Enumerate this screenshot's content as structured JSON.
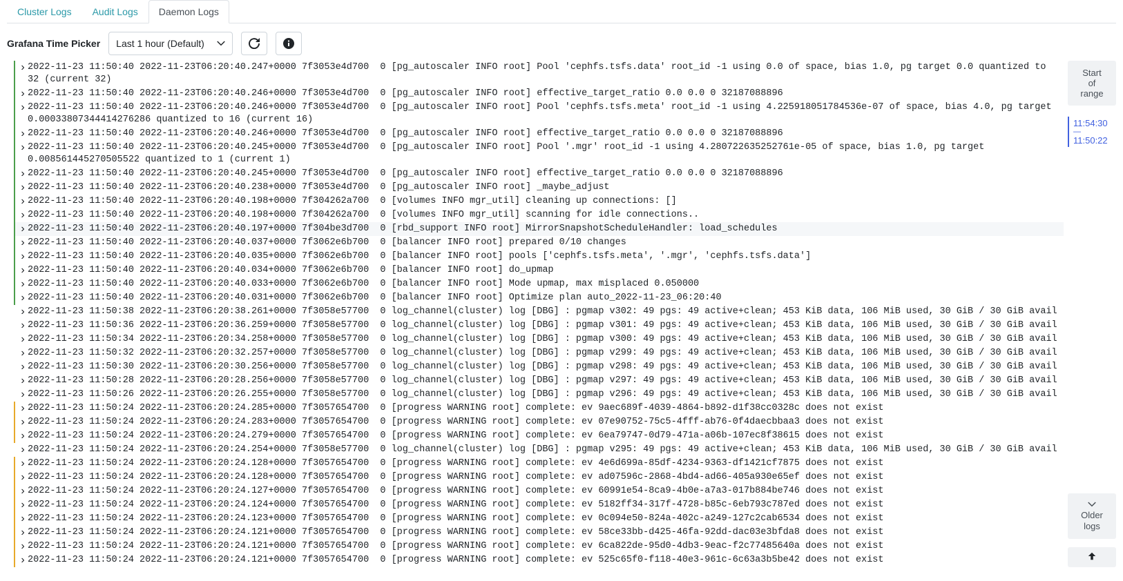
{
  "tabs": [
    {
      "label": "Cluster Logs",
      "active": false
    },
    {
      "label": "Audit Logs",
      "active": false
    },
    {
      "label": "Daemon Logs",
      "active": true
    }
  ],
  "toolbar": {
    "picker_label": "Grafana Time Picker",
    "range_value": "Last 1 hour (Default)"
  },
  "side": {
    "start_label": "Start\nof\nrange",
    "link_top": "11:54:30",
    "link_sep": "—",
    "link_bottom": "11:50:22",
    "older_label": "Older\nlogs"
  },
  "logs": [
    {
      "lvl": "info",
      "hover": false,
      "text": "2022-11-23 11:50:40 2022-11-23T06:20:40.247+0000 7f3053e4d700  0 [pg_autoscaler INFO root] Pool 'cephfs.tsfs.data' root_id -1 using 0.0 of space, bias 1.0, pg target 0.0 quantized to 32 (current 32)"
    },
    {
      "lvl": "info",
      "hover": false,
      "text": "2022-11-23 11:50:40 2022-11-23T06:20:40.246+0000 7f3053e4d700  0 [pg_autoscaler INFO root] effective_target_ratio 0.0 0.0 0 32187088896"
    },
    {
      "lvl": "info",
      "hover": false,
      "text": "2022-11-23 11:50:40 2022-11-23T06:20:40.246+0000 7f3053e4d700  0 [pg_autoscaler INFO root] Pool 'cephfs.tsfs.meta' root_id -1 using 4.225918051784536e-07 of space, bias 4.0, pg target 0.00033807344414276286 quantized to 16 (current 16)"
    },
    {
      "lvl": "info",
      "hover": false,
      "text": "2022-11-23 11:50:40 2022-11-23T06:20:40.246+0000 7f3053e4d700  0 [pg_autoscaler INFO root] effective_target_ratio 0.0 0.0 0 32187088896"
    },
    {
      "lvl": "info",
      "hover": false,
      "text": "2022-11-23 11:50:40 2022-11-23T06:20:40.245+0000 7f3053e4d700  0 [pg_autoscaler INFO root] Pool '.mgr' root_id -1 using 4.280722635252761e-05 of space, bias 1.0, pg target 0.008561445270505522 quantized to 1 (current 1)"
    },
    {
      "lvl": "info",
      "hover": false,
      "text": "2022-11-23 11:50:40 2022-11-23T06:20:40.245+0000 7f3053e4d700  0 [pg_autoscaler INFO root] effective_target_ratio 0.0 0.0 0 32187088896"
    },
    {
      "lvl": "info",
      "hover": false,
      "text": "2022-11-23 11:50:40 2022-11-23T06:20:40.238+0000 7f3053e4d700  0 [pg_autoscaler INFO root] _maybe_adjust"
    },
    {
      "lvl": "info",
      "hover": false,
      "text": "2022-11-23 11:50:40 2022-11-23T06:20:40.198+0000 7f304262a700  0 [volumes INFO mgr_util] cleaning up connections: []"
    },
    {
      "lvl": "info",
      "hover": false,
      "text": "2022-11-23 11:50:40 2022-11-23T06:20:40.198+0000 7f304262a700  0 [volumes INFO mgr_util] scanning for idle connections.."
    },
    {
      "lvl": "info",
      "hover": true,
      "text": "2022-11-23 11:50:40 2022-11-23T06:20:40.197+0000 7f304be3d700  0 [rbd_support INFO root] MirrorSnapshotScheduleHandler: load_schedules"
    },
    {
      "lvl": "info",
      "hover": false,
      "text": "2022-11-23 11:50:40 2022-11-23T06:20:40.037+0000 7f3062e6b700  0 [balancer INFO root] prepared 0/10 changes"
    },
    {
      "lvl": "info",
      "hover": false,
      "text": "2022-11-23 11:50:40 2022-11-23T06:20:40.035+0000 7f3062e6b700  0 [balancer INFO root] pools ['cephfs.tsfs.meta', '.mgr', 'cephfs.tsfs.data']"
    },
    {
      "lvl": "info",
      "hover": false,
      "text": "2022-11-23 11:50:40 2022-11-23T06:20:40.034+0000 7f3062e6b700  0 [balancer INFO root] do_upmap"
    },
    {
      "lvl": "info",
      "hover": false,
      "text": "2022-11-23 11:50:40 2022-11-23T06:20:40.033+0000 7f3062e6b700  0 [balancer INFO root] Mode upmap, max misplaced 0.050000"
    },
    {
      "lvl": "info",
      "hover": false,
      "text": "2022-11-23 11:50:40 2022-11-23T06:20:40.031+0000 7f3062e6b700  0 [balancer INFO root] Optimize plan auto_2022-11-23_06:20:40"
    },
    {
      "lvl": "dbg",
      "hover": false,
      "text": "2022-11-23 11:50:38 2022-11-23T06:20:38.261+0000 7f3058e57700  0 log_channel(cluster) log [DBG] : pgmap v302: 49 pgs: 49 active+clean; 453 KiB data, 106 MiB used, 30 GiB / 30 GiB avail"
    },
    {
      "lvl": "dbg",
      "hover": false,
      "text": "2022-11-23 11:50:36 2022-11-23T06:20:36.259+0000 7f3058e57700  0 log_channel(cluster) log [DBG] : pgmap v301: 49 pgs: 49 active+clean; 453 KiB data, 106 MiB used, 30 GiB / 30 GiB avail"
    },
    {
      "lvl": "dbg",
      "hover": false,
      "text": "2022-11-23 11:50:34 2022-11-23T06:20:34.258+0000 7f3058e57700  0 log_channel(cluster) log [DBG] : pgmap v300: 49 pgs: 49 active+clean; 453 KiB data, 106 MiB used, 30 GiB / 30 GiB avail"
    },
    {
      "lvl": "dbg",
      "hover": false,
      "text": "2022-11-23 11:50:32 2022-11-23T06:20:32.257+0000 7f3058e57700  0 log_channel(cluster) log [DBG] : pgmap v299: 49 pgs: 49 active+clean; 453 KiB data, 106 MiB used, 30 GiB / 30 GiB avail"
    },
    {
      "lvl": "dbg",
      "hover": false,
      "text": "2022-11-23 11:50:30 2022-11-23T06:20:30.256+0000 7f3058e57700  0 log_channel(cluster) log [DBG] : pgmap v298: 49 pgs: 49 active+clean; 453 KiB data, 106 MiB used, 30 GiB / 30 GiB avail"
    },
    {
      "lvl": "dbg",
      "hover": false,
      "text": "2022-11-23 11:50:28 2022-11-23T06:20:28.256+0000 7f3058e57700  0 log_channel(cluster) log [DBG] : pgmap v297: 49 pgs: 49 active+clean; 453 KiB data, 106 MiB used, 30 GiB / 30 GiB avail"
    },
    {
      "lvl": "dbg",
      "hover": false,
      "text": "2022-11-23 11:50:26 2022-11-23T06:20:26.255+0000 7f3058e57700  0 log_channel(cluster) log [DBG] : pgmap v296: 49 pgs: 49 active+clean; 453 KiB data, 106 MiB used, 30 GiB / 30 GiB avail"
    },
    {
      "lvl": "warn",
      "hover": false,
      "text": "2022-11-23 11:50:24 2022-11-23T06:20:24.285+0000 7f3057654700  0 [progress WARNING root] complete: ev 9aec689f-4039-4864-b892-d1f38cc0328c does not exist"
    },
    {
      "lvl": "warn",
      "hover": false,
      "text": "2022-11-23 11:50:24 2022-11-23T06:20:24.283+0000 7f3057654700  0 [progress WARNING root] complete: ev 07e90752-75c5-4fff-ab76-0f4daecbbaa3 does not exist"
    },
    {
      "lvl": "warn",
      "hover": false,
      "text": "2022-11-23 11:50:24 2022-11-23T06:20:24.279+0000 7f3057654700  0 [progress WARNING root] complete: ev 6ea79747-0d79-471a-a06b-107ec8f38615 does not exist"
    },
    {
      "lvl": "dbg",
      "hover": false,
      "text": "2022-11-23 11:50:24 2022-11-23T06:20:24.254+0000 7f3058e57700  0 log_channel(cluster) log [DBG] : pgmap v295: 49 pgs: 49 active+clean; 453 KiB data, 106 MiB used, 30 GiB / 30 GiB avail"
    },
    {
      "lvl": "warn",
      "hover": false,
      "text": "2022-11-23 11:50:24 2022-11-23T06:20:24.128+0000 7f3057654700  0 [progress WARNING root] complete: ev 4e6d699a-85df-4234-9363-df1421cf7875 does not exist"
    },
    {
      "lvl": "warn",
      "hover": false,
      "text": "2022-11-23 11:50:24 2022-11-23T06:20:24.128+0000 7f3057654700  0 [progress WARNING root] complete: ev ad07596c-2868-4bd4-ad66-405a930e65ef does not exist"
    },
    {
      "lvl": "warn",
      "hover": false,
      "text": "2022-11-23 11:50:24 2022-11-23T06:20:24.127+0000 7f3057654700  0 [progress WARNING root] complete: ev 60991e54-8ca9-4b0e-a7a3-017b884be746 does not exist"
    },
    {
      "lvl": "warn",
      "hover": false,
      "text": "2022-11-23 11:50:24 2022-11-23T06:20:24.124+0000 7f3057654700  0 [progress WARNING root] complete: ev 5182ff34-317f-4728-b85c-6eb793c787ed does not exist"
    },
    {
      "lvl": "warn",
      "hover": false,
      "text": "2022-11-23 11:50:24 2022-11-23T06:20:24.123+0000 7f3057654700  0 [progress WARNING root] complete: ev 0c094e50-824a-402c-a249-127c2cab6534 does not exist"
    },
    {
      "lvl": "warn",
      "hover": false,
      "text": "2022-11-23 11:50:24 2022-11-23T06:20:24.121+0000 7f3057654700  0 [progress WARNING root] complete: ev 58ce33bb-d425-46fa-92dd-dac03e3bfda8 does not exist"
    },
    {
      "lvl": "warn",
      "hover": false,
      "text": "2022-11-23 11:50:24 2022-11-23T06:20:24.121+0000 7f3057654700  0 [progress WARNING root] complete: ev 6ca822de-95d0-4db3-9eac-f2c77485640a does not exist"
    },
    {
      "lvl": "warn",
      "hover": false,
      "text": "2022-11-23 11:50:24 2022-11-23T06:20:24.121+0000 7f3057654700  0 [progress WARNING root] complete: ev 525c65f0-f118-40e3-961c-6c63a3b5be42 does not exist"
    }
  ]
}
